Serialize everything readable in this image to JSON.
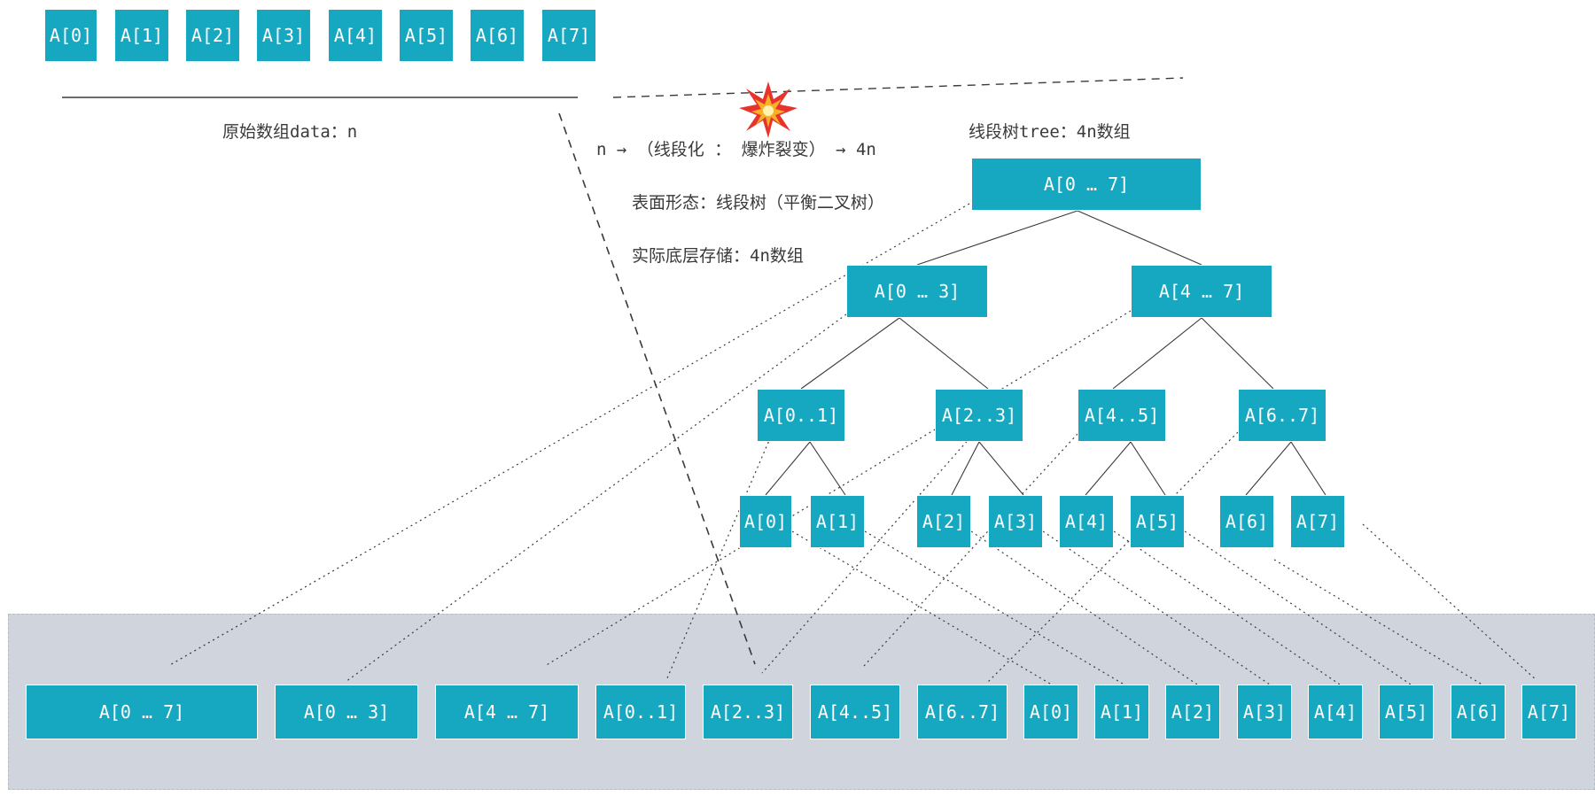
{
  "original_array": {
    "cells": [
      "A[0]",
      "A[1]",
      "A[2]",
      "A[3]",
      "A[4]",
      "A[5]",
      "A[6]",
      "A[7]"
    ],
    "caption": "原始数组data：n"
  },
  "transform": {
    "line1": "n → （线段化 ： 爆炸裂变） → 4n",
    "line2": "表面形态：线段树（平衡二叉树）",
    "line3": "实际底层存储：4n数组",
    "burst_icon": "collision-burst"
  },
  "tree": {
    "caption": "线段树tree：4n数组",
    "root": "A[0 … 7]",
    "level1": [
      "A[0 … 3]",
      "A[4 … 7]"
    ],
    "level2": [
      "A[0..1]",
      "A[2..3]",
      "A[4..5]",
      "A[6..7]"
    ],
    "leaves": [
      "A[0]",
      "A[1]",
      "A[2]",
      "A[3]",
      "A[4]",
      "A[5]",
      "A[6]",
      "A[7]"
    ]
  },
  "storage": {
    "cells": [
      "A[0 … 7]",
      "A[0 … 3]",
      "A[4 … 7]",
      "A[0..1]",
      "A[2..3]",
      "A[4..5]",
      "A[6..7]",
      "A[0]",
      "A[1]",
      "A[2]",
      "A[3]",
      "A[4]",
      "A[5]",
      "A[6]",
      "A[7]"
    ]
  },
  "colors": {
    "node": "#16a8c0",
    "panel": "#cfd4dd",
    "edge": "#3a3a3a"
  }
}
